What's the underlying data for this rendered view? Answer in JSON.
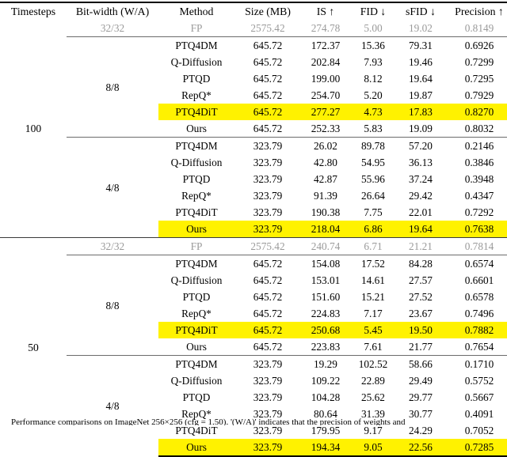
{
  "table": {
    "columns": [
      {
        "key": "timesteps",
        "label": "Timesteps"
      },
      {
        "key": "bitwidth",
        "label": "Bit-width (W/A)"
      },
      {
        "key": "method",
        "label": "Method"
      },
      {
        "key": "size",
        "label": "Size (MB)"
      },
      {
        "key": "is",
        "label": "IS ↑"
      },
      {
        "key": "fid",
        "label": "FID ↓"
      },
      {
        "key": "sfid",
        "label": "sFID ↓"
      },
      {
        "key": "precision",
        "label": "Precision ↑"
      }
    ],
    "highlight_color": "#FFF200",
    "fp_text_color": "#9a9a9a",
    "groups": [
      {
        "timesteps": "100",
        "fp": {
          "bitwidth": "32/32",
          "method": "FP",
          "size": "2575.42",
          "is": "274.78",
          "fid": "5.00",
          "sfid": "19.02",
          "precision": "0.8149"
        },
        "blocks": [
          {
            "bitwidth": "8/8",
            "rows": [
              {
                "method": "PTQ4DM",
                "size": "645.72",
                "is": "172.37",
                "fid": "15.36",
                "sfid": "79.31",
                "precision": "0.6926",
                "highlight": false,
                "bold_method": false,
                "bold_metrics": false
              },
              {
                "method": "Q-Diffusion",
                "size": "645.72",
                "is": "202.84",
                "fid": "7.93",
                "sfid": "19.46",
                "precision": "0.7299",
                "highlight": false,
                "bold_method": false,
                "bold_metrics": false
              },
              {
                "method": "PTQD",
                "size": "645.72",
                "is": "199.00",
                "fid": "8.12",
                "sfid": "19.64",
                "precision": "0.7295",
                "highlight": false,
                "bold_method": false,
                "bold_metrics": false
              },
              {
                "method": "RepQ*",
                "size": "645.72",
                "is": "254.70",
                "fid": "5.20",
                "sfid": "19.87",
                "precision": "0.7929",
                "highlight": false,
                "bold_method": false,
                "bold_metrics": false
              },
              {
                "method": "PTQ4DiT",
                "size": "645.72",
                "is": "277.27",
                "fid": "4.73",
                "sfid": "17.83",
                "precision": "0.8270",
                "highlight": true,
                "bold_method": false,
                "bold_metrics": true
              },
              {
                "method": "Ours",
                "size": "645.72",
                "is": "252.33",
                "fid": "5.83",
                "sfid": "19.09",
                "precision": "0.8032",
                "highlight": false,
                "bold_method": true,
                "bold_metrics": false
              }
            ]
          },
          {
            "bitwidth": "4/8",
            "rows": [
              {
                "method": "PTQ4DM",
                "size": "323.79",
                "is": "26.02",
                "fid": "89.78",
                "sfid": "57.20",
                "precision": "0.2146",
                "highlight": false,
                "bold_method": false,
                "bold_metrics": false
              },
              {
                "method": "Q-Diffusion",
                "size": "323.79",
                "is": "42.80",
                "fid": "54.95",
                "sfid": "36.13",
                "precision": "0.3846",
                "highlight": false,
                "bold_method": false,
                "bold_metrics": false
              },
              {
                "method": "PTQD",
                "size": "323.79",
                "is": "42.87",
                "fid": "55.96",
                "sfid": "37.24",
                "precision": "0.3948",
                "highlight": false,
                "bold_method": false,
                "bold_metrics": false
              },
              {
                "method": "RepQ*",
                "size": "323.79",
                "is": "91.39",
                "fid": "26.64",
                "sfid": "29.42",
                "precision": "0.4347",
                "highlight": false,
                "bold_method": false,
                "bold_metrics": false
              },
              {
                "method": "PTQ4DiT",
                "size": "323.79",
                "is": "190.38",
                "fid": "7.75",
                "sfid": "22.01",
                "precision": "0.7292",
                "highlight": false,
                "bold_method": false,
                "bold_metrics": false
              },
              {
                "method": "Ours",
                "size": "323.79",
                "is": "218.04",
                "fid": "6.86",
                "sfid": "19.64",
                "precision": "0.7638",
                "highlight": true,
                "bold_method": true,
                "bold_metrics": true
              }
            ]
          }
        ]
      },
      {
        "timesteps": "50",
        "fp": {
          "bitwidth": "32/32",
          "method": "FP",
          "size": "2575.42",
          "is": "240.74",
          "fid": "6.71",
          "sfid": "21.21",
          "precision": "0.7814"
        },
        "blocks": [
          {
            "bitwidth": "8/8",
            "rows": [
              {
                "method": "PTQ4DM",
                "size": "645.72",
                "is": "154.08",
                "fid": "17.52",
                "sfid": "84.28",
                "precision": "0.6574",
                "highlight": false,
                "bold_method": false,
                "bold_metrics": false
              },
              {
                "method": "Q-Diffusion",
                "size": "645.72",
                "is": "153.01",
                "fid": "14.61",
                "sfid": "27.57",
                "precision": "0.6601",
                "highlight": false,
                "bold_method": false,
                "bold_metrics": false
              },
              {
                "method": "PTQD",
                "size": "645.72",
                "is": "151.60",
                "fid": "15.21",
                "sfid": "27.52",
                "precision": "0.6578",
                "highlight": false,
                "bold_method": false,
                "bold_metrics": false
              },
              {
                "method": "RepQ*",
                "size": "645.72",
                "is": "224.83",
                "fid": "7.17",
                "sfid": "23.67",
                "precision": "0.7496",
                "highlight": false,
                "bold_method": false,
                "bold_metrics": false
              },
              {
                "method": "PTQ4DiT",
                "size": "645.72",
                "is": "250.68",
                "fid": "5.45",
                "sfid": "19.50",
                "precision": "0.7882",
                "highlight": true,
                "bold_method": false,
                "bold_metrics": true
              },
              {
                "method": "Ours",
                "size": "645.72",
                "is": "223.83",
                "fid": "7.61",
                "sfid": "21.77",
                "precision": "0.7654",
                "highlight": false,
                "bold_method": true,
                "bold_metrics": false
              }
            ]
          },
          {
            "bitwidth": "4/8",
            "rows": [
              {
                "method": "PTQ4DM",
                "size": "323.79",
                "is": "19.29",
                "fid": "102.52",
                "sfid": "58.66",
                "precision": "0.1710",
                "highlight": false,
                "bold_method": false,
                "bold_metrics": false
              },
              {
                "method": "Q-Diffusion",
                "size": "323.79",
                "is": "109.22",
                "fid": "22.89",
                "sfid": "29.49",
                "precision": "0.5752",
                "highlight": false,
                "bold_method": false,
                "bold_metrics": false
              },
              {
                "method": "PTQD",
                "size": "323.79",
                "is": "104.28",
                "fid": "25.62",
                "sfid": "29.77",
                "precision": "0.5667",
                "highlight": false,
                "bold_method": false,
                "bold_metrics": false
              },
              {
                "method": "RepQ*",
                "size": "323.79",
                "is": "80.64",
                "fid": "31.39",
                "sfid": "30.77",
                "precision": "0.4091",
                "highlight": false,
                "bold_method": false,
                "bold_metrics": false
              },
              {
                "method": "PTQ4DiT",
                "size": "323.79",
                "is": "179.95",
                "fid": "9.17",
                "sfid": "24.29",
                "precision": "0.7052",
                "highlight": false,
                "bold_method": false,
                "bold_metrics": false
              },
              {
                "method": "Ours",
                "size": "323.79",
                "is": "194.34",
                "fid": "9.05",
                "sfid": "22.56",
                "precision": "0.7285",
                "highlight": true,
                "bold_method": true,
                "bold_metrics": true
              }
            ]
          }
        ]
      }
    ]
  },
  "caption": {
    "text": "Performance comparisons on ImageNet 256×256 (cfg = 1.50). '(W/A)' indicates that the precision of weights and"
  }
}
